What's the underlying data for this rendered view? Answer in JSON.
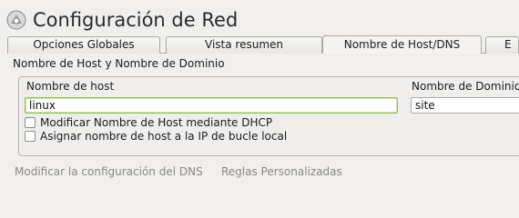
{
  "window": {
    "title": "Configuración de Red",
    "icon": "network-config-icon"
  },
  "tabs": [
    {
      "label": "Opciones Globales",
      "active": false
    },
    {
      "label": "Vista resumen",
      "active": false
    },
    {
      "label": "Nombre de Host/DNS",
      "active": true
    },
    {
      "label": "E",
      "active": false
    }
  ],
  "section": {
    "title": "Nombre de Host y Nombre de Dominio"
  },
  "hostname": {
    "label": "Nombre de host",
    "value": "linux"
  },
  "domain": {
    "label": "Nombre de Dominio",
    "value": "site"
  },
  "checkboxes": [
    {
      "label": "Modificar Nombre de Host mediante DHCP",
      "checked": false
    },
    {
      "label": "Asignar nombre de host a la IP de bucle local",
      "checked": false
    }
  ],
  "bottom": {
    "dns_link": "Modificar la configuración del DNS",
    "rules_link": "Reglas Personalizadas"
  },
  "colors": {
    "focus_border": "#8fc04a",
    "background": "#f0efee",
    "disabled_text": "#8b8a88"
  }
}
